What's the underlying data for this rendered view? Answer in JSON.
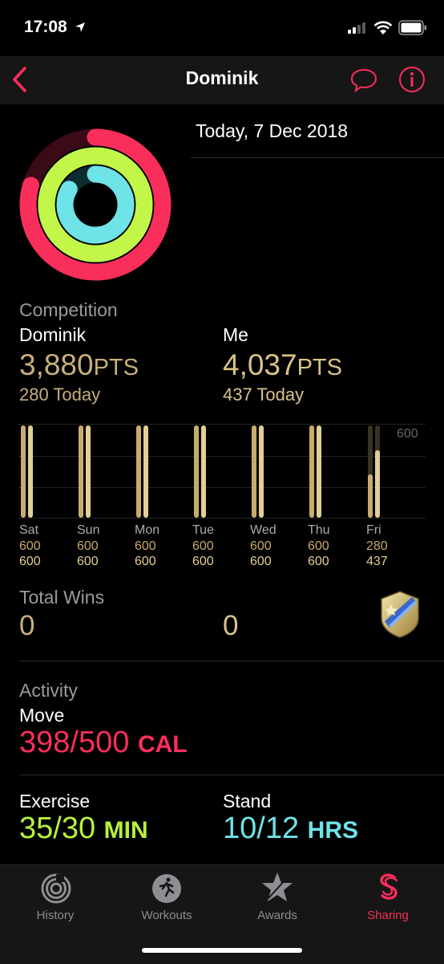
{
  "status_bar": {
    "time": "17:08"
  },
  "nav": {
    "title": "Dominik"
  },
  "date": "Today, 7 Dec 2018",
  "competition": {
    "heading": "Competition",
    "opponent": {
      "name": "Dominik",
      "points": "3,880",
      "unit": "PTS",
      "today": "280 Today"
    },
    "me": {
      "name": "Me",
      "points": "4,037",
      "unit": "PTS",
      "today": "437 Today"
    }
  },
  "chart_data": {
    "type": "bar",
    "ymax_label": "600",
    "ylim": [
      0,
      600
    ],
    "categories": [
      "Sat",
      "Sun",
      "Mon",
      "Tue",
      "Wed",
      "Thu",
      "Fri"
    ],
    "series": [
      {
        "values": [
          600,
          600,
          600,
          600,
          600,
          600,
          280
        ]
      },
      {
        "values": [
          600,
          600,
          600,
          600,
          600,
          600,
          437
        ]
      }
    ]
  },
  "total_wins": {
    "heading": "Total Wins",
    "opponent": "0",
    "me": "0"
  },
  "activity": {
    "heading": "Activity",
    "move": {
      "label": "Move",
      "value": "398/500",
      "unit": "CAL",
      "color": "#fa2e5b",
      "progress": 0.796
    },
    "exercise": {
      "label": "Exercise",
      "value": "35/30",
      "unit": "MIN",
      "color": "#b6f23a",
      "progress": 1.1667
    },
    "stand": {
      "label": "Stand",
      "value": "10/12",
      "unit": "HRS",
      "color": "#6ee3e8",
      "progress": 0.8333
    }
  },
  "tabs": [
    {
      "label": "History",
      "icon": "history-icon"
    },
    {
      "label": "Workouts",
      "icon": "workouts-icon"
    },
    {
      "label": "Awards",
      "icon": "awards-icon"
    },
    {
      "label": "Sharing",
      "icon": "sharing-icon",
      "active": true
    }
  ],
  "colors": {
    "accent": "#fa2e5b",
    "gold": "#d8c287",
    "background": "#000000"
  }
}
